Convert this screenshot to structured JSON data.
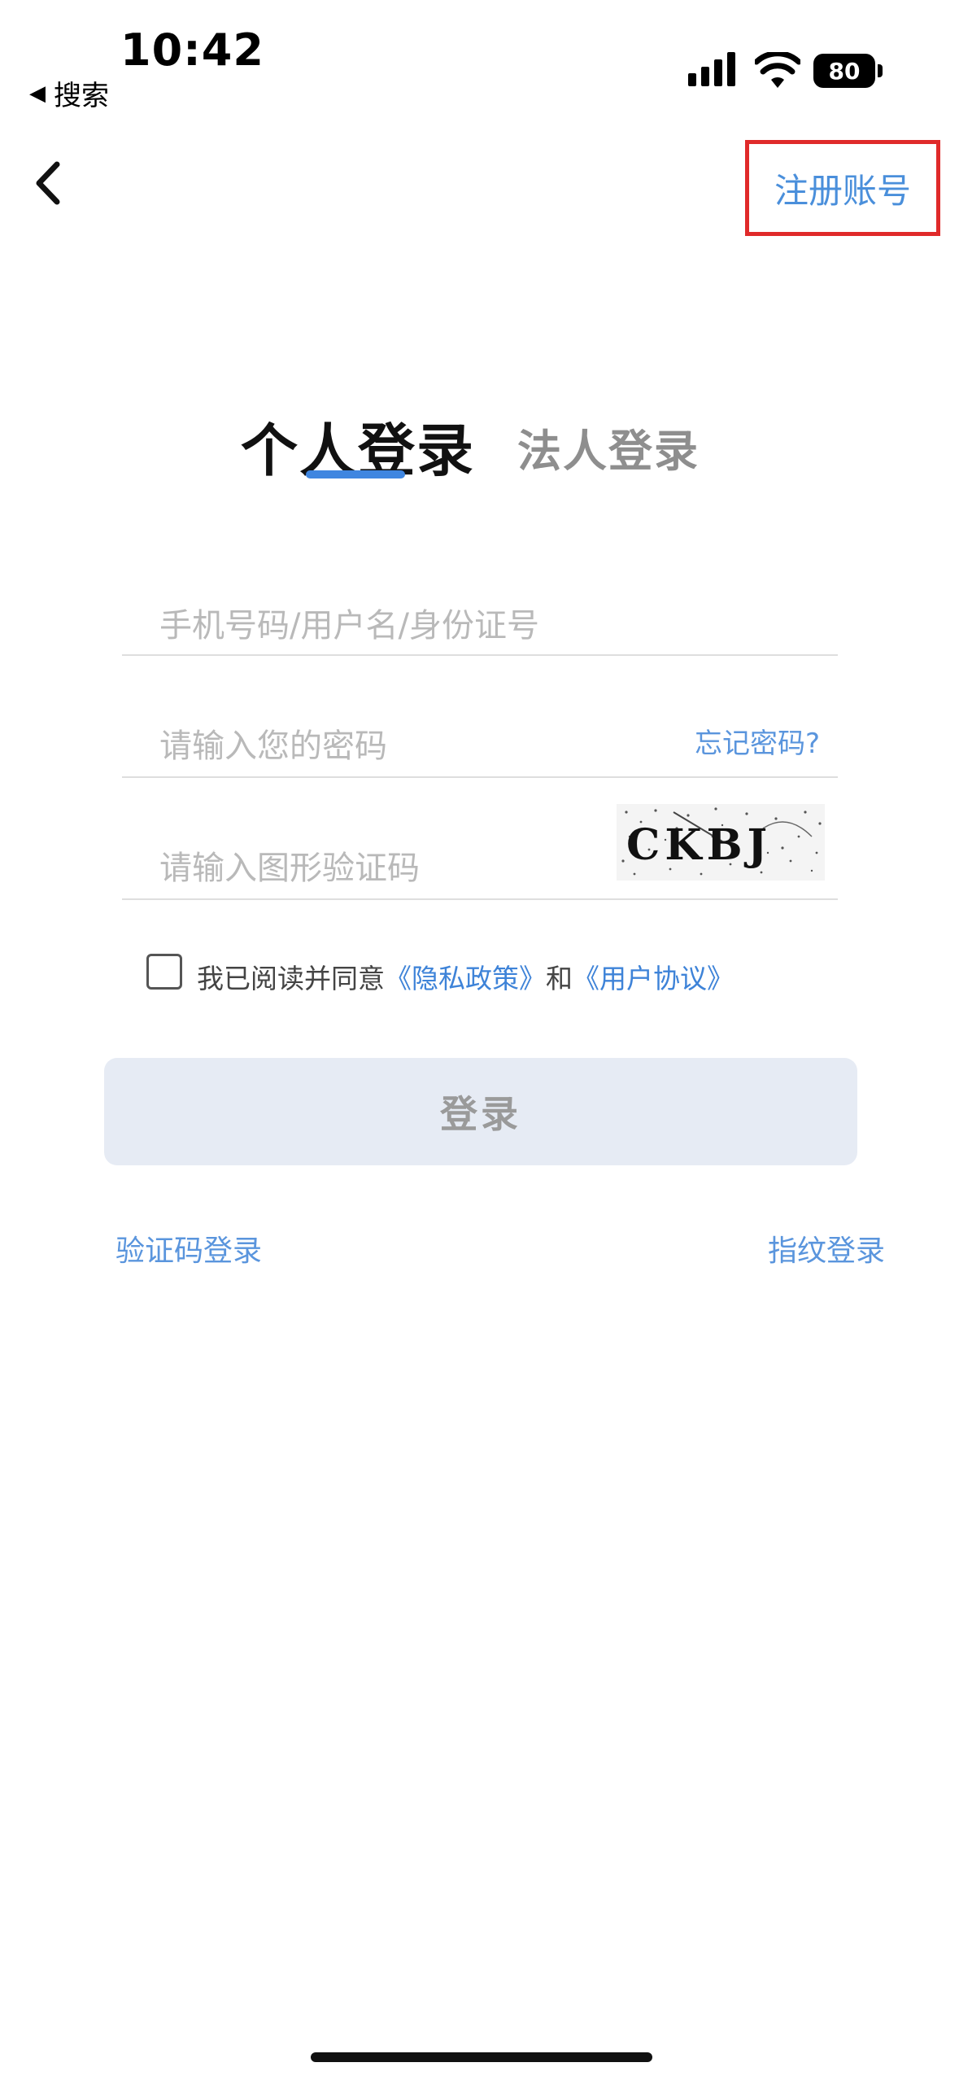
{
  "status_bar": {
    "time": "10:42",
    "back_label": "搜索",
    "battery": "80"
  },
  "nav": {
    "register_label": "注册账号"
  },
  "tabs": [
    {
      "label": "个人登录",
      "active": true
    },
    {
      "label": "法人登录",
      "active": false
    }
  ],
  "form": {
    "account_placeholder": "手机号码/用户名/身份证号",
    "password_placeholder": "请输入您的密码",
    "forgot_label": "忘记密码?",
    "captcha_placeholder": "请输入图形验证码",
    "captcha_text": "CKBJ"
  },
  "agreement": {
    "prefix": "我已阅读并同意",
    "privacy_link": "《隐私政策》",
    "and": "和",
    "user_link": "《用户协议》",
    "checked": false
  },
  "login_button": "登录",
  "alt_login": {
    "sms": "验证码登录",
    "fingerprint": "指纹登录"
  },
  "colors": {
    "accent": "#4a8fdb",
    "highlight_border": "#e02a2a",
    "button_bg": "#e6ebf4"
  }
}
